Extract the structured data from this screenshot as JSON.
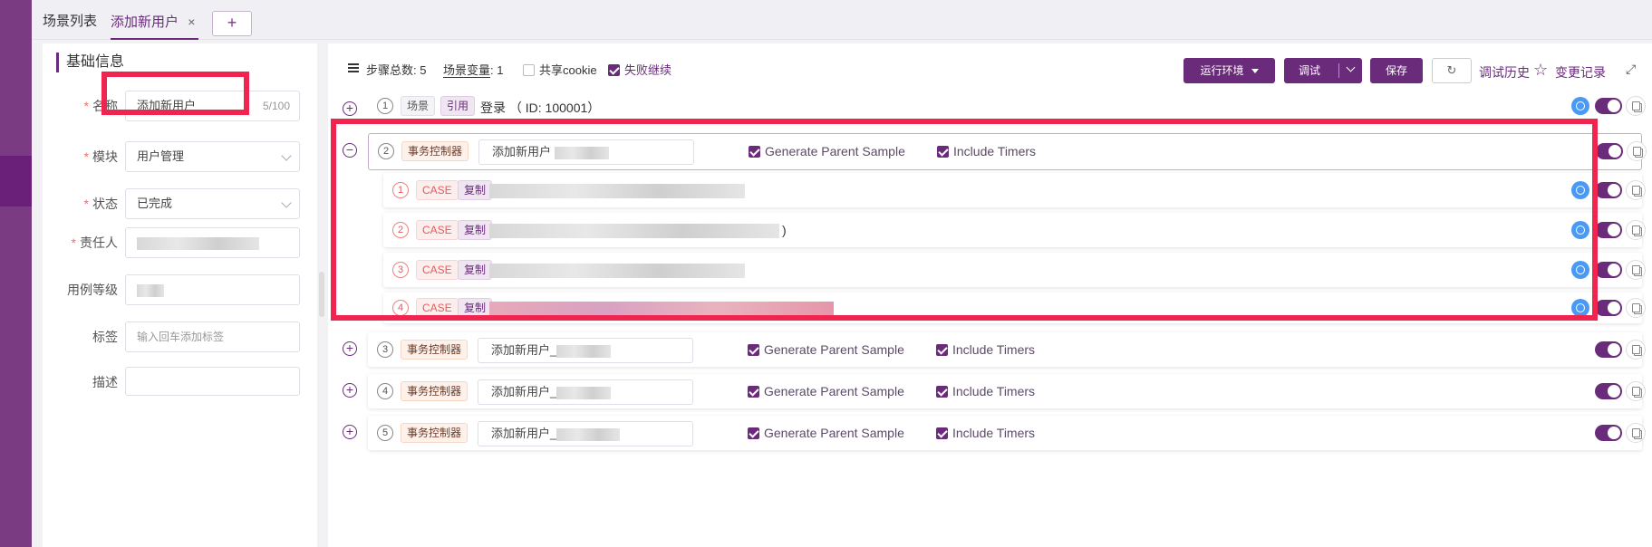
{
  "tabs": {
    "scene_list": "场景列表",
    "add_user": "添加新用户",
    "close": "×",
    "add": "+"
  },
  "basic_info": {
    "title": "基础信息",
    "name_label": "名称",
    "name_value": "添加新用户",
    "name_count": "5/100",
    "module_label": "模块",
    "module_value": "用户管理",
    "status_label": "状态",
    "status_value": "已完成",
    "owner_label": "责任人",
    "level_label": "用例等级",
    "tags_label": "标签",
    "tags_placeholder": "输入回车添加标签",
    "desc_label": "描述"
  },
  "toolbar": {
    "step_total_label": "步骤总数:",
    "step_total_value": "5",
    "scene_var_label": "场景变量",
    "scene_var_value": ": 1",
    "share_cookie": "共享cookie",
    "fail_continue": "失败继续",
    "run_env": "运行环境",
    "debug": "调试",
    "save": "保存",
    "debug_history": "调试历史",
    "change_log": "变更记录"
  },
  "steps": {
    "s1": {
      "num": "1",
      "tag1": "场景",
      "tag2": "引用",
      "text": "登录 （ ID: 100001）"
    },
    "s2": {
      "num": "2",
      "tag": "事务控制器",
      "name": "添加新用户",
      "opt1": "Generate Parent Sample",
      "opt2": "Include Timers"
    },
    "c1": {
      "num": "1",
      "tag1": "CASE",
      "tag2": "复制"
    },
    "c2": {
      "num": "2",
      "tag1": "CASE",
      "tag2": "复制",
      "tail": ")"
    },
    "c3": {
      "num": "3",
      "tag1": "CASE",
      "tag2": "复制"
    },
    "c4": {
      "num": "4",
      "tag1": "CASE",
      "tag2": "复制"
    },
    "s3": {
      "num": "3",
      "tag": "事务控制器",
      "name": "添加新用户_",
      "opt1": "Generate Parent Sample",
      "opt2": "Include Timers"
    },
    "s4": {
      "num": "4",
      "tag": "事务控制器",
      "name": "添加新用户_",
      "opt1": "Generate Parent Sample",
      "opt2": "Include Timers"
    },
    "s5": {
      "num": "5",
      "tag": "事务控制器",
      "name": "添加新用户_",
      "opt1": "Generate Parent Sample",
      "opt2": "Include Timers"
    }
  },
  "symbols": {
    "more": "•••",
    "plus": "+",
    "minus": "−",
    "refresh": "↻",
    "star": "☆",
    "expand": "⤢"
  },
  "colors": {
    "accent": "#6a2c7a",
    "highlight": "#f0254f",
    "play": "#4a9af5",
    "required": "#f56c6c"
  }
}
